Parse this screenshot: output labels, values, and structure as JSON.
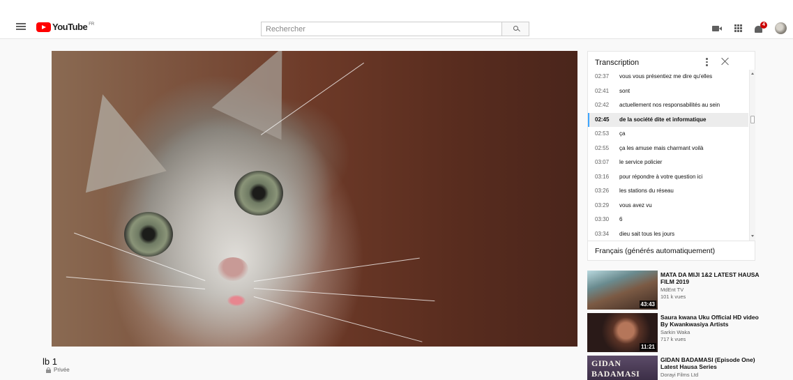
{
  "header": {
    "logo_text": "YouTube",
    "logo_country": "FR",
    "search_placeholder": "Rechercher",
    "notification_count": "4"
  },
  "video": {
    "title": "lb 1",
    "privacy": "Privée"
  },
  "transcript": {
    "title": "Transcription",
    "language": "Français (générés automatiquement)",
    "rows": [
      {
        "time": "02:37",
        "text": "vous vous présentiez me dire qu'elles"
      },
      {
        "time": "02:41",
        "text": "sont"
      },
      {
        "time": "02:42",
        "text": "actuellement nos responsabilités au sein"
      },
      {
        "time": "02:45",
        "text": "de la société dite et informatique"
      },
      {
        "time": "02:53",
        "text": "ça"
      },
      {
        "time": "02:55",
        "text": "ça les amuse mais charmant voilà"
      },
      {
        "time": "03:07",
        "text": "le service policier"
      },
      {
        "time": "03:16",
        "text": "pour répondre à votre question ici"
      },
      {
        "time": "03:26",
        "text": "les stations du réseau"
      },
      {
        "time": "03:29",
        "text": "vous avez vu"
      },
      {
        "time": "03:30",
        "text": "6"
      },
      {
        "time": "03:34",
        "text": "dieu sait tous les jours"
      }
    ]
  },
  "recommendations": [
    {
      "title": "MATA DA MIJI 1&2 LATEST HAUSA FILM 2019",
      "channel": "MdEnt TV",
      "views": "101 k vues",
      "duration": "43:43"
    },
    {
      "title": "Saura kwana Uku Official HD video By Kwankwasiya Artists",
      "channel": "Sarkin Waka",
      "views": "717 k vues",
      "duration": "11:21"
    },
    {
      "title": "GIDAN BADAMASI (Episode One) Latest Hausa Series",
      "channel": "Dorayi Films Ltd",
      "views": "",
      "duration": "",
      "thumb_text": "GIDAN BADAMASI"
    }
  ]
}
